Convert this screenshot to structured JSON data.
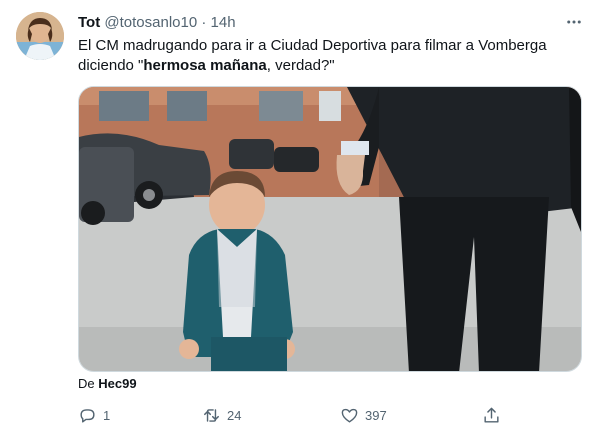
{
  "tweet": {
    "author_name": "Tot",
    "author_handle": "@totosanlo10",
    "separator": "·",
    "time": "14h",
    "text_part1": "El CM madrugando para ir a Ciudad Deportiva para filmar a Vomberga diciendo \"",
    "text_bold": "hermosa mañana",
    "text_part2": ", verdad?\""
  },
  "media_credit": {
    "prefix": "De",
    "user": "Hec99"
  },
  "actions": {
    "reply_count": "1",
    "retweet_count": "24",
    "like_count": "397"
  },
  "icons": {
    "more": "more-dots-icon",
    "reply": "reply-icon",
    "retweet": "retweet-icon",
    "like": "heart-icon",
    "share": "share-icon"
  },
  "colors": {
    "text_primary": "#0f1419",
    "text_secondary": "#536471",
    "border": "#cfd9de"
  }
}
